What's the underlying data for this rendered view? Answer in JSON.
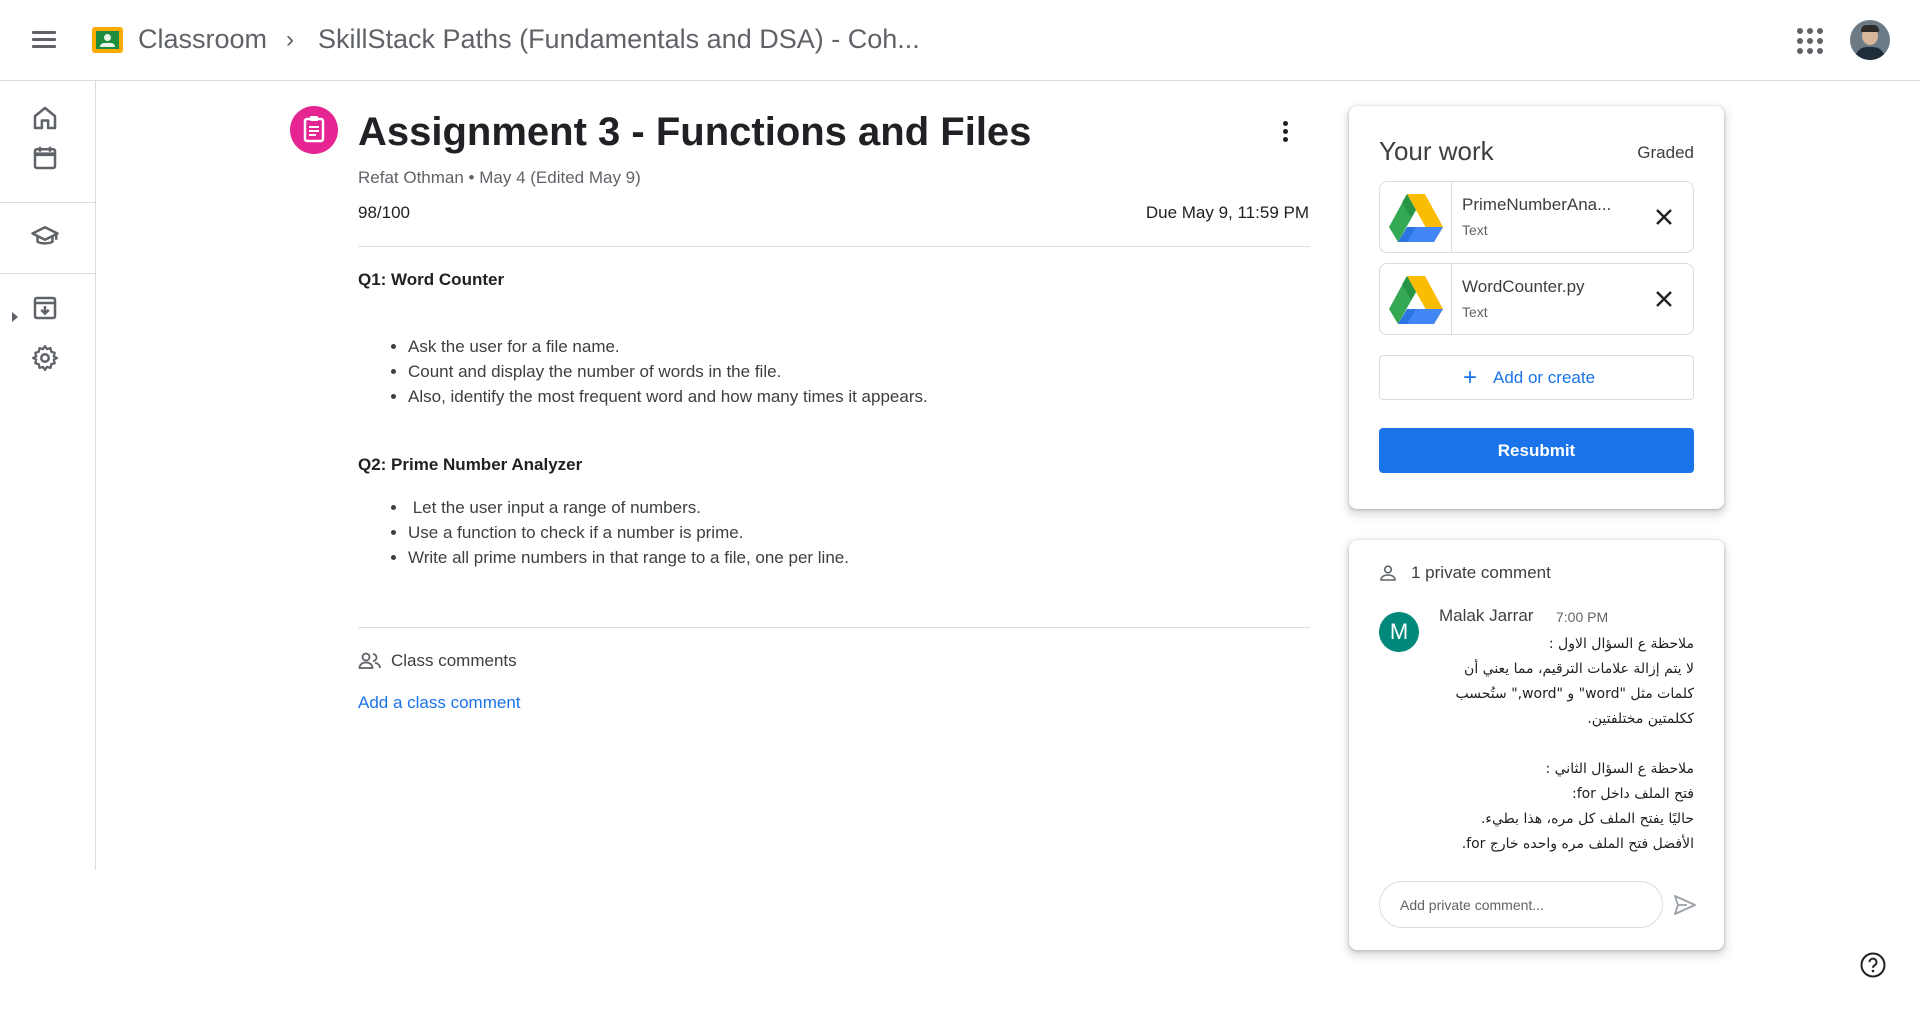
{
  "header": {
    "app_title": "Classroom",
    "breadcrumb_separator": "›",
    "course_title": "SkillStack Paths (Fundamentals and DSA) - Coh..."
  },
  "icons": {
    "menu": "menu-icon",
    "logo": "classroom-logo",
    "apps": "google-apps-icon",
    "avatar": "user-avatar",
    "home": "home-icon",
    "calendar": "calendar-icon",
    "enrolled": "school-hat-icon",
    "todo": "archive-download-icon",
    "settings": "gear-icon",
    "assignment": "assignment-clipboard-icon",
    "more": "more-vert-icon",
    "class_comments": "people-icon",
    "private_comment": "person-icon",
    "send": "send-icon",
    "remove": "close-icon",
    "drive": "google-drive-icon",
    "help": "help-icon"
  },
  "colors": {
    "accent": "#1a73e8",
    "assignment_icon_bg": "#e52592",
    "commenter_avatar": "#00897b"
  },
  "assignment": {
    "title": "Assignment 3 - Functions and Files",
    "author": "Refat Othman",
    "meta_separator": " • ",
    "posted": "May 4 (Edited May 9)",
    "grade": "98/100",
    "due": "Due May 9, 11:59 PM",
    "questions": [
      {
        "title": "Q1: Word Counter",
        "items": [
          "Ask the user for a file name.",
          "Count and display the number of words in the file.",
          "Also, identify the most frequent word and how many times it appears."
        ]
      },
      {
        "title": "Q2: Prime Number Analyzer",
        "items": [
          " Let the user input a range of numbers.",
          "Use a function to check if a number is prime.",
          "Write all prime numbers in that range to a file, one per line."
        ]
      }
    ]
  },
  "class_comments": {
    "title": "Class comments",
    "add_link": "Add a class comment"
  },
  "your_work": {
    "title": "Your work",
    "status": "Graded",
    "attachments": [
      {
        "name": "PrimeNumberAna...",
        "type": "Text"
      },
      {
        "name": "WordCounter.py",
        "type": "Text"
      }
    ],
    "add_or_create": "Add or create",
    "resubmit": "Resubmit"
  },
  "private_comments": {
    "header": "1 private comment",
    "comments": [
      {
        "author": "Malak Jarrar",
        "initial": "M",
        "time": "7:00 PM",
        "lines": [
          "ملاحظة ع السؤال الاول :",
          "لا يتم إزالة علامات الترقيم، مما يعني أن",
          "كلمات مثل \"word\" و \"word,\" ستُحسب",
          "ككلمتين مختلفتين.",
          "",
          "ملاحظة ع السؤال الثاني :",
          "فتح الملف داخل for:",
          "حاليًا يفتح الملف كل مره، هذا بطيء.",
          "الأفضل فتح الملف مره واحده خارج for."
        ]
      }
    ],
    "placeholder": "Add private comment..."
  }
}
